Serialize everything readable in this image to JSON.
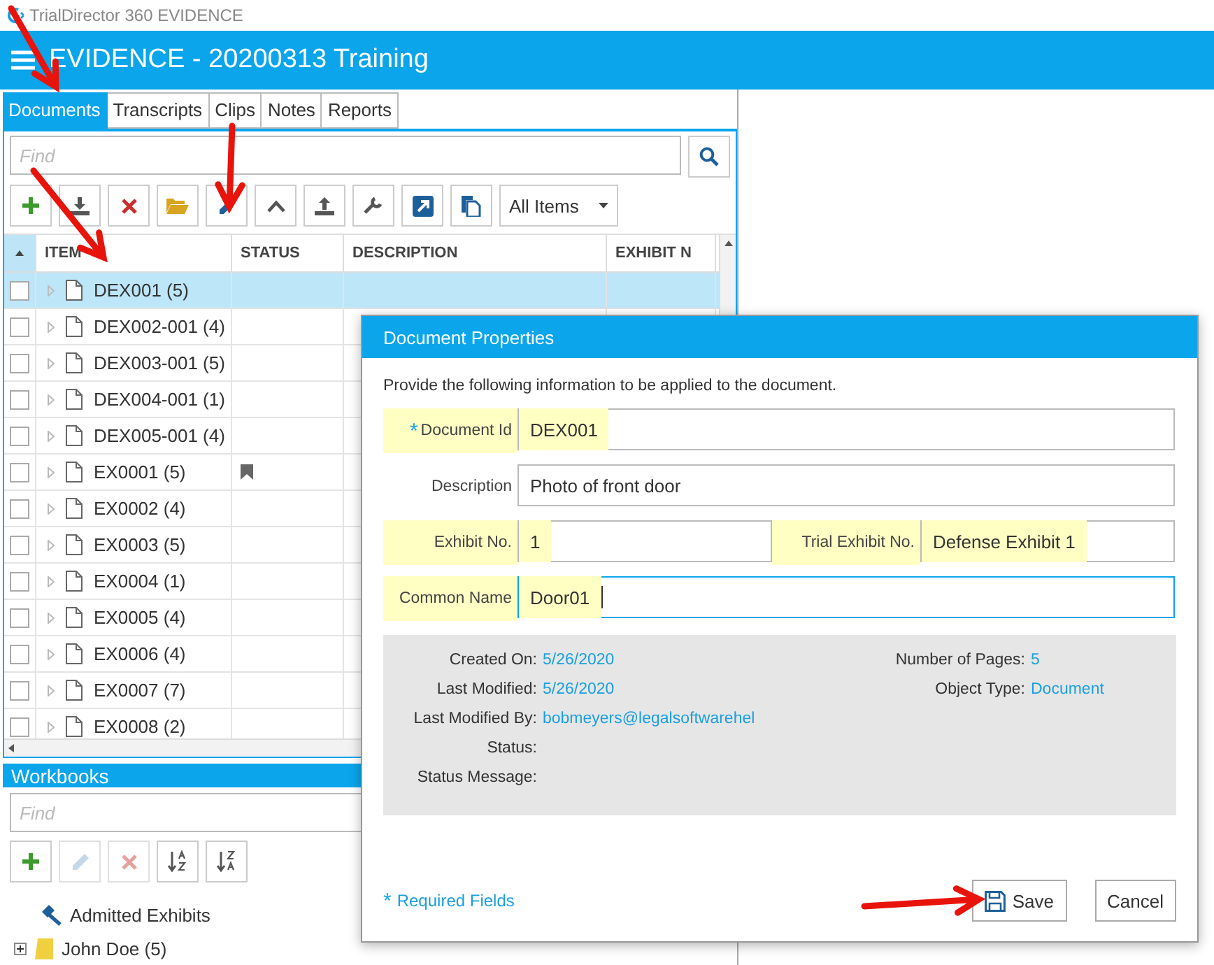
{
  "app_title": "TrialDirector 360 EVIDENCE",
  "header": {
    "title": "EVIDENCE - 20200313 Training"
  },
  "tabs": [
    {
      "label": "Documents",
      "selected": true
    },
    {
      "label": "Transcripts",
      "selected": false
    },
    {
      "label": "Clips",
      "selected": false
    },
    {
      "label": "Notes",
      "selected": false
    },
    {
      "label": "Reports",
      "selected": false
    }
  ],
  "search": {
    "placeholder": "Find"
  },
  "toolbar": {
    "buttons": [
      {
        "kind": "add"
      },
      {
        "kind": "import"
      },
      {
        "kind": "delete"
      },
      {
        "kind": "folder"
      },
      {
        "kind": "edit"
      },
      {
        "kind": "up"
      },
      {
        "kind": "upload"
      },
      {
        "kind": "wrench"
      },
      {
        "kind": "open"
      },
      {
        "kind": "copy"
      }
    ],
    "filter": "All Items"
  },
  "table": {
    "columns": [
      "ITEM",
      "STATUS",
      "DESCRIPTION",
      "EXHIBIT N"
    ],
    "rows": [
      {
        "item": "DEX001 (5)",
        "selected": true,
        "checked": false,
        "bookmarked": false
      },
      {
        "item": "DEX002-001 (4)",
        "selected": false,
        "checked": false,
        "bookmarked": false
      },
      {
        "item": "DEX003-001 (5)",
        "selected": false,
        "checked": false,
        "bookmarked": false
      },
      {
        "item": "DEX004-001 (1)",
        "selected": false,
        "checked": false,
        "bookmarked": false
      },
      {
        "item": "DEX005-001 (4)",
        "selected": false,
        "checked": false,
        "bookmarked": false
      },
      {
        "item": "EX0001 (5)",
        "selected": false,
        "checked": false,
        "bookmarked": true
      },
      {
        "item": "EX0002 (4)",
        "selected": false,
        "checked": false,
        "bookmarked": false
      },
      {
        "item": "EX0003 (5)",
        "selected": false,
        "checked": false,
        "bookmarked": false
      },
      {
        "item": "EX0004 (1)",
        "selected": false,
        "checked": false,
        "bookmarked": false
      },
      {
        "item": "EX0005 (4)",
        "selected": false,
        "checked": false,
        "bookmarked": false
      },
      {
        "item": "EX0006 (4)",
        "selected": false,
        "checked": false,
        "bookmarked": false
      },
      {
        "item": "EX0007 (7)",
        "selected": false,
        "checked": false,
        "bookmarked": false
      },
      {
        "item": "EX0008 (2)",
        "selected": false,
        "checked": false,
        "bookmarked": false
      }
    ]
  },
  "workbooks": {
    "title": "Workbooks",
    "search": {
      "placeholder": "Find"
    },
    "toolbar": [
      {
        "kind": "add",
        "disabled": false
      },
      {
        "kind": "edit",
        "disabled": true
      },
      {
        "kind": "delete",
        "disabled": true
      },
      {
        "kind": "sort-asc",
        "disabled": false
      },
      {
        "kind": "sort-desc",
        "disabled": false
      }
    ],
    "items": [
      {
        "kind": "admitted",
        "label": "Admitted Exhibits"
      },
      {
        "kind": "workbook",
        "label": "John Doe (5)",
        "expanded": false
      }
    ]
  },
  "dialog": {
    "title": "Document Properties",
    "intro": "Provide the following information to be applied to the document.",
    "fields": [
      {
        "label": "Document Id",
        "value": "DEX001",
        "required": true,
        "highlighted": true,
        "focused": false
      },
      {
        "label": "Description",
        "value": "Photo of front door",
        "required": false,
        "highlighted": false,
        "focused": false
      },
      {
        "label": "Exhibit No.",
        "value": "1",
        "required": false,
        "highlighted": true,
        "focused": false
      },
      {
        "label": "Trial Exhibit No.",
        "value": "Defense Exhibit 1",
        "required": false,
        "highlighted": true,
        "focused": false
      },
      {
        "label": "Common Name",
        "value": "Door01",
        "required": false,
        "highlighted": true,
        "focused": true
      }
    ],
    "info_left": [
      {
        "label": "Created On:",
        "value": "5/26/2020"
      },
      {
        "label": "Last Modified:",
        "value": "5/26/2020"
      },
      {
        "label": "Last Modified By:",
        "value": "bobmeyers@legalsoftwarehel"
      },
      {
        "label": "Status:"
      },
      {
        "label": "Status Message:"
      }
    ],
    "info_right": [
      {
        "label": "Number of Pages:",
        "value": "5"
      },
      {
        "label": "Object Type:",
        "value": "Document"
      }
    ],
    "required_mark": "*",
    "required_note": "Required Fields",
    "buttons": [
      {
        "kind": "save",
        "label": "Save"
      },
      {
        "kind": "cancel",
        "label": "Cancel"
      }
    ]
  }
}
